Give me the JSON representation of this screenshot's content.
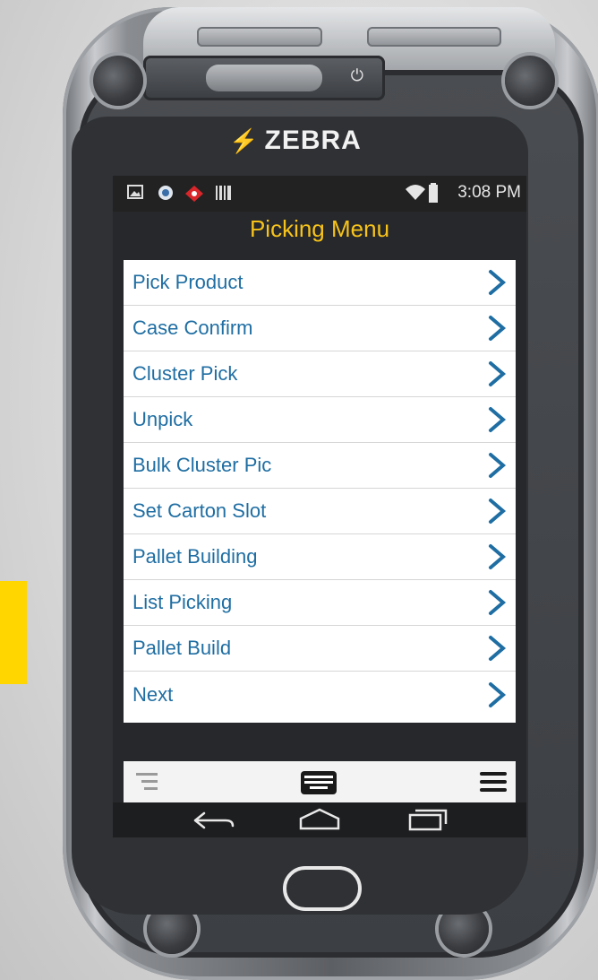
{
  "device": {
    "brand": "ZEBRA"
  },
  "statusbar": {
    "icons": [
      "image-icon",
      "app-icon",
      "alert-diamond-icon",
      "barcode-icon"
    ],
    "right_icons": [
      "wifi-icon",
      "battery-icon"
    ],
    "time": "3:08 PM"
  },
  "screen": {
    "title": "Picking Menu"
  },
  "menu": {
    "items": [
      {
        "label": "Pick Product"
      },
      {
        "label": "Case Confirm"
      },
      {
        "label": "Cluster Pick"
      },
      {
        "label": "Unpick"
      },
      {
        "label": "Bulk Cluster Pic"
      },
      {
        "label": "Set Carton Slot"
      },
      {
        "label": "Pallet Building"
      },
      {
        "label": "List Picking"
      },
      {
        "label": "Pallet Build"
      },
      {
        "label": "Next"
      }
    ]
  },
  "toolbar": {
    "icons": [
      "left-menu-icon",
      "keyboard-icon",
      "hamburger-menu-icon"
    ]
  },
  "navbar": {
    "icons": [
      "back-icon",
      "home-icon",
      "recents-icon"
    ]
  },
  "colors": {
    "title": "#f7c31a",
    "menu_text": "#1f6ea3",
    "accent_strip": "#ffd600"
  }
}
